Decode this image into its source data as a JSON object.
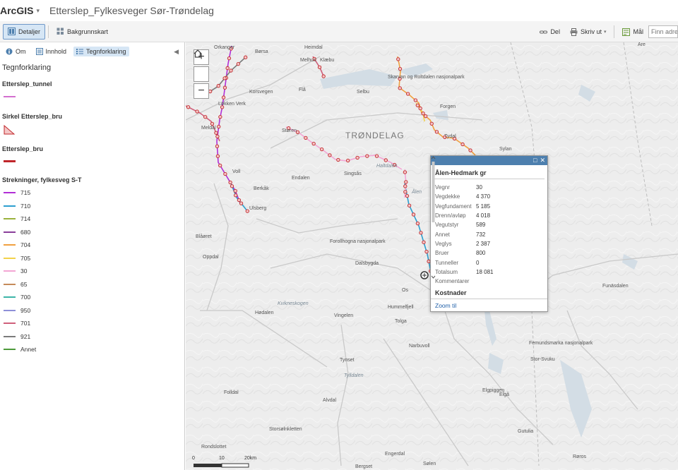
{
  "app": {
    "brand": "ArcGIS",
    "caret": "▾",
    "map_title": "Etterslep_Fylkesveger Sør-Trøndelag"
  },
  "toolbar": {
    "details": "Detaljer",
    "basemap": "Bakgrunnskart",
    "share": "Del",
    "print": "Skriv ut",
    "print_caret": "▾",
    "measure": "Mål",
    "search_placeholder": "Finn adre"
  },
  "sidebar": {
    "tabs": {
      "about": "Om",
      "content": "Innhold",
      "legend": "Tegnforklaring"
    },
    "legend_heading": "Tegnforklaring",
    "layers": {
      "tunnel": {
        "title": "Etterslep_tunnel",
        "color": "#d36fcf"
      },
      "bridge_circle": {
        "title": "Sirkel Etterslep_bru",
        "color": "#e58a8a"
      },
      "bridge": {
        "title": "Etterslep_bru",
        "color": "#c0262a"
      },
      "roads": {
        "title": "Strekninger, fylkesveg S-T",
        "items": [
          {
            "label": "715",
            "color": "#b12ed6"
          },
          {
            "label": "710",
            "color": "#2c9fcf"
          },
          {
            "label": "714",
            "color": "#9ab23c"
          },
          {
            "label": "680",
            "color": "#8a3e9a"
          },
          {
            "label": "704",
            "color": "#f0a040"
          },
          {
            "label": "705",
            "color": "#f2d24a"
          },
          {
            "label": "30",
            "color": "#f3a6d4"
          },
          {
            "label": "65",
            "color": "#c58a5a"
          },
          {
            "label": "700",
            "color": "#3db5a8"
          },
          {
            "label": "950",
            "color": "#8e8fd8"
          },
          {
            "label": "701",
            "color": "#cf5f7a"
          },
          {
            "label": "921",
            "color": "#7a7a7a"
          },
          {
            "label": "Annet",
            "color": "#4d9a3a"
          }
        ]
      }
    }
  },
  "map": {
    "labels": [
      "Orkanger",
      "Børsa",
      "Heimdal",
      "Melhus",
      "Klæbu",
      "Selbu",
      "Skarvan og Roltdalen nasjonalpark",
      "Forgen",
      "Tydal",
      "Flå",
      "Korsvegen",
      "Løkken Verk",
      "Meldal",
      "Støren",
      "TRØNDELAG",
      "Singsås",
      "Haltdalen",
      "Ålen",
      "Sylan",
      "Voll",
      "Berkåk",
      "Ulsberg",
      "Endalen",
      "Forollhogna nasjonalpark",
      "Blåøret",
      "Oppdal",
      "Dalsbygda",
      "Os",
      "Hummelfjell",
      "Tolga",
      "Vingelen",
      "Hødalen",
      "Kvikneskogen",
      "Narbuvoll",
      "Tynset",
      "Folldal",
      "Alvdal",
      "Tylldalen",
      "Femundsmarka nasjonalpark",
      "Stor-Svuku",
      "Elgå",
      "Elgpiggen",
      "Gutulia",
      "Funäsdalen",
      "Rondslottet",
      "Åre",
      "Storsølnkletten",
      "Sølen",
      "Engerdal",
      "Bergset",
      "Røros"
    ],
    "zoom_in": "+",
    "zoom_out": "−",
    "scale": {
      "labels": [
        "0",
        "10",
        "20km"
      ]
    }
  },
  "popup": {
    "title": "Ålen-Hedmark gr",
    "rows": [
      {
        "key": "Vegnr",
        "value": "30"
      },
      {
        "key": "Vegdekke",
        "value": "4 370"
      },
      {
        "key": "Vegfundament",
        "value": "5 185"
      },
      {
        "key": "Drenn/avløp",
        "value": "4 018"
      },
      {
        "key": "Vegutstyr",
        "value": "589"
      },
      {
        "key": "Annet",
        "value": "732"
      },
      {
        "key": "Veglys",
        "value": "2 387"
      },
      {
        "key": "Bruer",
        "value": "800"
      },
      {
        "key": "Tunneller",
        "value": "0"
      },
      {
        "key": "Totalsum",
        "value": "18 081"
      },
      {
        "key": "Kommentarer",
        "value": ""
      }
    ],
    "section": "Kostnader",
    "zoom_to": "Zoom til",
    "maximize_icon": "□",
    "close_icon": "✕"
  }
}
